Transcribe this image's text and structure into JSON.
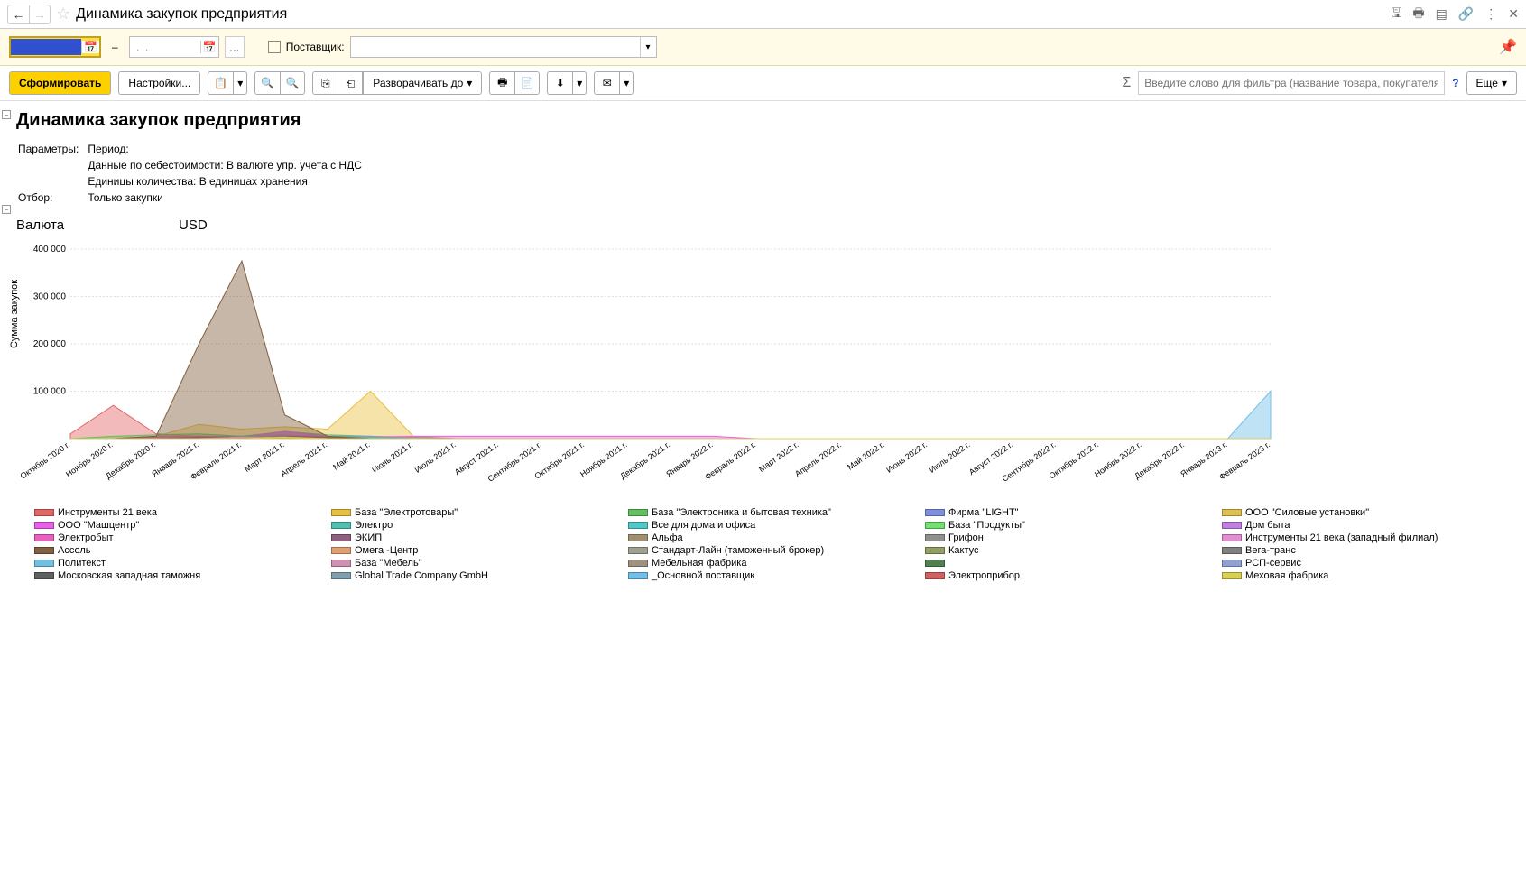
{
  "header": {
    "title": "Динамика закупок предприятия"
  },
  "filter": {
    "date_from": "",
    "date_to": " .  .",
    "supplier_label": "Поставщик:",
    "supplier_value": ""
  },
  "toolbar": {
    "form": "Сформировать",
    "settings": "Настройки...",
    "expand": "Разворачивать до",
    "more": "Еще",
    "filter_placeholder": "Введите слово для фильтра (название товара, покупателя и пр.)"
  },
  "report": {
    "title": "Динамика закупок предприятия",
    "params_label": "Параметры:",
    "param_period": "Период:",
    "param_cost": "Данные по себестоимости: В валюте упр. учета с НДС",
    "param_units": "Единицы количества: В единицах хранения",
    "filter_label": "Отбор:",
    "filter_value": "Только закупки",
    "currency_label": "Валюта",
    "currency_value": "USD"
  },
  "chart_data": {
    "type": "area",
    "ylabel": "Сумма закупок",
    "ylim": [
      0,
      400000
    ],
    "y_ticks": [
      100000,
      200000,
      300000,
      400000
    ],
    "y_tick_labels": [
      "100 000",
      "200 000",
      "300 000",
      "400 000"
    ],
    "categories": [
      "Октябрь 2020 г.",
      "Ноябрь 2020 г.",
      "Декабрь 2020 г.",
      "Январь 2021 г.",
      "Февраль 2021 г.",
      "Март 2021 г.",
      "Апрель 2021 г.",
      "Май 2021 г.",
      "Июнь 2021 г.",
      "Июль 2021 г.",
      "Август 2021 г.",
      "Сентябрь 2021 г.",
      "Октябрь 2021 г.",
      "Ноябрь 2021 г.",
      "Декабрь 2021 г.",
      "Январь 2022 г.",
      "Февраль 2022 г.",
      "Март 2022 г.",
      "Апрель 2022 г.",
      "Май 2022 г.",
      "Июнь 2022 г.",
      "Июль 2022 г.",
      "Август 2022 г.",
      "Сентябрь 2022 г.",
      "Октябрь 2022 г.",
      "Ноябрь 2022 г.",
      "Декабрь 2022 г.",
      "Январь 2023 г.",
      "Февраль 2023 г."
    ],
    "series": [
      {
        "name": "Инструменты 21 века",
        "color": "#e36666",
        "values": [
          10000,
          70000,
          10000,
          5000,
          5000,
          5000,
          5000,
          0,
          0,
          0,
          0,
          0,
          0,
          0,
          0,
          0,
          0,
          0,
          0,
          0,
          0,
          0,
          0,
          0,
          0,
          0,
          0,
          0,
          0
        ]
      },
      {
        "name": "База \"Электротовары\"",
        "color": "#e8c040",
        "values": [
          0,
          0,
          5000,
          30000,
          20000,
          25000,
          20000,
          100000,
          5000,
          0,
          0,
          0,
          0,
          0,
          0,
          0,
          0,
          0,
          0,
          0,
          0,
          0,
          0,
          0,
          0,
          0,
          0,
          0,
          0
        ]
      },
      {
        "name": "База \"Электроника и бытовая техника\"",
        "color": "#60c060",
        "values": [
          0,
          5000,
          8000,
          10000,
          5000,
          15000,
          8000,
          5000,
          3000,
          0,
          0,
          0,
          0,
          0,
          0,
          0,
          0,
          0,
          0,
          0,
          0,
          0,
          0,
          0,
          0,
          0,
          0,
          0,
          0
        ]
      },
      {
        "name": "Фирма \"LIGHT\"",
        "color": "#8090e0",
        "values": [
          0,
          0,
          5000,
          5000,
          3000,
          15000,
          5000,
          5000,
          0,
          0,
          0,
          0,
          0,
          0,
          0,
          0,
          0,
          0,
          0,
          0,
          0,
          0,
          0,
          0,
          0,
          0,
          0,
          0,
          0
        ]
      },
      {
        "name": "ООО \"Силовые установки\"",
        "color": "#e0c050",
        "values": [
          0,
          0,
          0,
          5000,
          3000,
          5000,
          3000,
          0,
          0,
          0,
          0,
          0,
          0,
          0,
          0,
          0,
          0,
          0,
          0,
          0,
          0,
          0,
          0,
          0,
          0,
          0,
          0,
          0,
          0
        ]
      },
      {
        "name": "ООО \"Машцентр\"",
        "color": "#e860e8",
        "values": [
          0,
          0,
          5000,
          5000,
          3000,
          15000,
          5000,
          3000,
          5000,
          5000,
          5000,
          5000,
          5000,
          5000,
          5000,
          5000,
          0,
          0,
          0,
          0,
          0,
          0,
          0,
          0,
          0,
          0,
          0,
          0,
          0
        ]
      },
      {
        "name": "Электро",
        "color": "#50c0b0",
        "values": [
          0,
          0,
          3000,
          5000,
          5000,
          8000,
          5000,
          3000,
          0,
          0,
          0,
          0,
          0,
          0,
          0,
          0,
          0,
          0,
          0,
          0,
          0,
          0,
          0,
          0,
          0,
          0,
          0,
          0,
          0
        ]
      },
      {
        "name": "Все для дома и офиса",
        "color": "#50c8c8",
        "values": [
          0,
          0,
          0,
          3000,
          3000,
          5000,
          3000,
          0,
          0,
          0,
          0,
          0,
          0,
          0,
          0,
          0,
          0,
          0,
          0,
          0,
          0,
          0,
          0,
          0,
          0,
          0,
          0,
          0,
          0
        ]
      },
      {
        "name": "База \"Продукты\"",
        "color": "#70e070",
        "values": [
          0,
          0,
          0,
          0,
          0,
          5000,
          3000,
          0,
          0,
          0,
          0,
          0,
          0,
          0,
          0,
          0,
          0,
          0,
          0,
          0,
          0,
          0,
          0,
          0,
          0,
          0,
          0,
          0,
          0
        ]
      },
      {
        "name": "Дом быта",
        "color": "#c080e0",
        "values": [
          0,
          0,
          0,
          3000,
          3000,
          5000,
          3000,
          0,
          0,
          0,
          0,
          0,
          0,
          0,
          0,
          0,
          0,
          0,
          0,
          0,
          0,
          0,
          0,
          0,
          0,
          0,
          0,
          0,
          0
        ]
      },
      {
        "name": "Электробыт",
        "color": "#e860c0",
        "values": [
          0,
          0,
          3000,
          5000,
          3000,
          8000,
          5000,
          0,
          0,
          0,
          0,
          0,
          0,
          0,
          0,
          0,
          0,
          0,
          0,
          0,
          0,
          0,
          0,
          0,
          0,
          0,
          0,
          0,
          0
        ]
      },
      {
        "name": "ЭКИП",
        "color": "#906080",
        "values": [
          0,
          0,
          0,
          3000,
          3000,
          5000,
          3000,
          0,
          0,
          0,
          0,
          0,
          0,
          0,
          0,
          0,
          0,
          0,
          0,
          0,
          0,
          0,
          0,
          0,
          0,
          0,
          0,
          0,
          0
        ]
      },
      {
        "name": "Альфа",
        "color": "#a09070",
        "values": [
          0,
          0,
          0,
          0,
          3000,
          3000,
          0,
          0,
          0,
          0,
          0,
          0,
          0,
          0,
          0,
          0,
          0,
          0,
          0,
          0,
          0,
          0,
          0,
          0,
          0,
          0,
          0,
          0,
          0
        ]
      },
      {
        "name": "Грифон",
        "color": "#909090",
        "values": [
          0,
          0,
          0,
          0,
          3000,
          3000,
          0,
          0,
          0,
          0,
          0,
          0,
          0,
          0,
          0,
          0,
          0,
          0,
          0,
          0,
          0,
          0,
          0,
          0,
          0,
          0,
          0,
          0,
          0
        ]
      },
      {
        "name": "Инструменты 21 века (западный филиал)",
        "color": "#e090d0",
        "values": [
          0,
          0,
          0,
          0,
          0,
          3000,
          0,
          0,
          0,
          0,
          0,
          0,
          0,
          0,
          0,
          0,
          0,
          0,
          0,
          0,
          0,
          0,
          0,
          0,
          0,
          0,
          0,
          0,
          0
        ]
      },
      {
        "name": "Ассоль",
        "color": "#806040",
        "values": [
          0,
          0,
          5000,
          200000,
          375000,
          50000,
          5000,
          0,
          0,
          0,
          0,
          0,
          0,
          0,
          0,
          0,
          0,
          0,
          0,
          0,
          0,
          0,
          0,
          0,
          0,
          0,
          0,
          0,
          0
        ]
      },
      {
        "name": "Омега -Центр",
        "color": "#e0a070",
        "values": [
          0,
          0,
          0,
          0,
          3000,
          3000,
          0,
          0,
          0,
          0,
          0,
          0,
          0,
          0,
          0,
          0,
          0,
          0,
          0,
          0,
          0,
          0,
          0,
          0,
          0,
          0,
          0,
          0,
          0
        ]
      },
      {
        "name": "Стандарт-Лайн (таможенный брокер)",
        "color": "#a0a090",
        "values": [
          0,
          0,
          0,
          0,
          0,
          3000,
          0,
          0,
          0,
          0,
          0,
          0,
          0,
          0,
          0,
          0,
          0,
          0,
          0,
          0,
          0,
          0,
          0,
          0,
          0,
          0,
          0,
          0,
          0
        ]
      },
      {
        "name": "Кактус",
        "color": "#90a060",
        "values": [
          0,
          0,
          0,
          0,
          0,
          3000,
          0,
          0,
          0,
          0,
          0,
          0,
          0,
          0,
          0,
          0,
          0,
          0,
          0,
          0,
          0,
          0,
          0,
          0,
          0,
          0,
          0,
          0,
          0
        ]
      },
      {
        "name": "Вега-транс",
        "color": "#808080",
        "values": [
          0,
          0,
          0,
          0,
          0,
          3000,
          0,
          0,
          0,
          0,
          0,
          0,
          0,
          0,
          0,
          0,
          0,
          0,
          0,
          0,
          0,
          0,
          0,
          0,
          0,
          0,
          0,
          0,
          0
        ]
      },
      {
        "name": "Политекст",
        "color": "#70c0e0",
        "values": [
          0,
          0,
          0,
          0,
          0,
          0,
          0,
          0,
          0,
          0,
          0,
          0,
          0,
          0,
          0,
          0,
          0,
          0,
          0,
          0,
          0,
          0,
          0,
          0,
          0,
          0,
          0,
          0,
          0
        ]
      },
      {
        "name": "База \"Мебель\"",
        "color": "#d090b0",
        "values": [
          0,
          0,
          0,
          0,
          3000,
          3000,
          0,
          0,
          0,
          0,
          0,
          0,
          0,
          0,
          0,
          0,
          0,
          0,
          0,
          0,
          0,
          0,
          0,
          0,
          0,
          0,
          0,
          0,
          0
        ]
      },
      {
        "name": "Мебельная фабрика",
        "color": "#a09080",
        "values": [
          0,
          0,
          0,
          0,
          0,
          3000,
          0,
          0,
          0,
          0,
          0,
          0,
          0,
          0,
          0,
          0,
          0,
          0,
          0,
          0,
          0,
          0,
          0,
          0,
          0,
          0,
          0,
          0,
          0
        ]
      },
      {
        "name": "",
        "color": "#508050",
        "values": [
          0,
          0,
          0,
          0,
          0,
          0,
          0,
          0,
          0,
          0,
          0,
          0,
          0,
          0,
          0,
          0,
          0,
          0,
          0,
          0,
          0,
          0,
          0,
          0,
          0,
          0,
          0,
          0,
          0
        ]
      },
      {
        "name": "РСП-сервис",
        "color": "#90a0d0",
        "values": [
          0,
          0,
          0,
          0,
          0,
          3000,
          0,
          0,
          0,
          0,
          0,
          0,
          0,
          0,
          0,
          0,
          0,
          0,
          0,
          0,
          0,
          0,
          0,
          0,
          0,
          0,
          0,
          0,
          0
        ]
      },
      {
        "name": "Московская западная таможня",
        "color": "#606060",
        "values": [
          0,
          0,
          0,
          0,
          0,
          3000,
          0,
          0,
          0,
          0,
          0,
          0,
          0,
          0,
          0,
          0,
          0,
          0,
          0,
          0,
          0,
          0,
          0,
          0,
          0,
          0,
          0,
          0,
          0
        ]
      },
      {
        "name": "Global Trade Company GmbH",
        "color": "#80a0b0",
        "values": [
          0,
          0,
          0,
          0,
          0,
          3000,
          0,
          0,
          0,
          0,
          0,
          0,
          0,
          0,
          0,
          0,
          0,
          0,
          0,
          0,
          0,
          0,
          0,
          0,
          0,
          0,
          0,
          0,
          0
        ]
      },
      {
        "name": "_Основной поставщик",
        "color": "#70c0e8",
        "values": [
          0,
          0,
          0,
          0,
          0,
          0,
          0,
          0,
          0,
          0,
          0,
          0,
          0,
          0,
          0,
          0,
          0,
          0,
          0,
          0,
          0,
          0,
          0,
          0,
          0,
          0,
          0,
          0,
          100000
        ]
      },
      {
        "name": "Электроприбор",
        "color": "#d06060",
        "values": [
          0,
          0,
          0,
          0,
          0,
          3000,
          0,
          0,
          0,
          0,
          0,
          0,
          0,
          0,
          0,
          0,
          0,
          0,
          0,
          0,
          0,
          0,
          0,
          0,
          0,
          0,
          0,
          0,
          0
        ]
      },
      {
        "name": "Меховая фабрика",
        "color": "#d8d050",
        "values": [
          0,
          0,
          0,
          0,
          0,
          3000,
          0,
          0,
          0,
          0,
          0,
          0,
          0,
          0,
          0,
          0,
          0,
          0,
          0,
          0,
          0,
          0,
          0,
          0,
          0,
          0,
          0,
          0,
          0
        ]
      }
    ]
  }
}
